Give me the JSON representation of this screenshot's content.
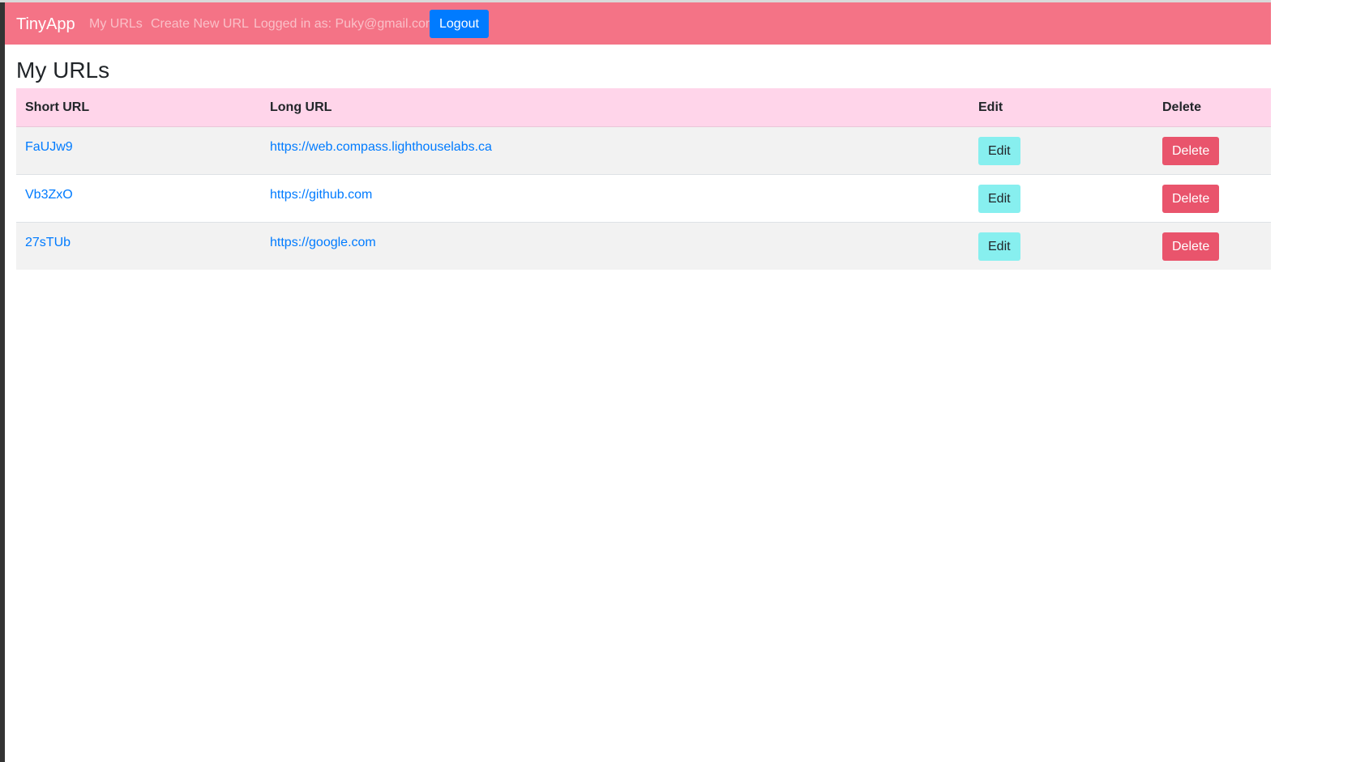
{
  "navbar": {
    "brand": "TinyApp",
    "links": {
      "my_urls": "My URLs",
      "create_new": "Create New URL",
      "logged_in": "Logged in as: Puky@gmail.com"
    },
    "logout_label": "Logout"
  },
  "main": {
    "title": "My URLs",
    "table": {
      "headers": {
        "short_url": "Short URL",
        "long_url": "Long URL",
        "edit": "Edit",
        "delete": "Delete"
      },
      "rows": [
        {
          "short": "FaUJw9",
          "long": "https://web.compass.lighthouselabs.ca",
          "edit_label": "Edit",
          "delete_label": "Delete"
        },
        {
          "short": "Vb3ZxO",
          "long": "https://github.com",
          "edit_label": "Edit",
          "delete_label": "Delete"
        },
        {
          "short": "27sTUb",
          "long": "https://google.com",
          "edit_label": "Edit",
          "delete_label": "Delete"
        }
      ]
    }
  },
  "colors": {
    "navbar": "#f47386",
    "header_row": "#ffd5ea",
    "logout": "#007bff",
    "edit_button": "#87efef",
    "delete_button": "#e9546c",
    "link": "#007bff"
  }
}
